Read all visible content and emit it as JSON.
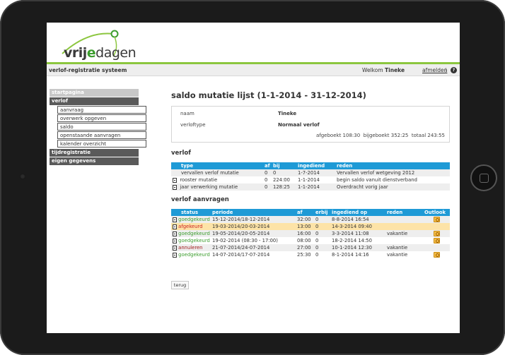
{
  "header": {
    "logo_part1": "vrij",
    "logo_part2": "e",
    "logo_part3": "dagen",
    "system_title": "verlof-registratie systeem",
    "welcome_label": "Welkom",
    "username": "Tineke",
    "logout_label": "afmelden",
    "separator": "|",
    "help_icon": "help-icon"
  },
  "sidebar": {
    "startpagina": "startpagina",
    "verlof": "verlof",
    "sub_items": [
      "aanvraag",
      "overwerk opgeven",
      "saldo",
      "openstaande aanvragen",
      "kalender overzicht"
    ],
    "tijdregistratie": "tijdregistratie",
    "eigen_gegevens": "eigen gegevens"
  },
  "main": {
    "title": "saldo mutatie lijst (1-1-2014 - 31-12-2014)",
    "info": {
      "naam_label": "naam",
      "naam_value": "Tineke",
      "verloftype_label": "verloftype",
      "verloftype_value": "Normaal verlof",
      "afgeboekt": "afgeboekt 108:30",
      "bijgeboekt": "bijgeboekt 352:25",
      "totaal": "totaal 243:55"
    },
    "verlof_section_title": "verlof",
    "verlof_table": {
      "headers": [
        "type",
        "af",
        "bij",
        "ingediend",
        "reden"
      ],
      "rows": [
        [
          "vervallen verlof mutatie",
          "0",
          "0",
          "1-7-2014",
          "Vervallen verlof wetgeving 2012"
        ],
        [
          "rooster mutatie",
          "0",
          "224:00",
          "1-1-2014",
          "begin saldo vanuit dienstverband"
        ],
        [
          "jaar verwerking mutatie",
          "0",
          "128:25",
          "1-1-2014",
          "Overdracht vorig jaar"
        ]
      ]
    },
    "aanvragen_section_title": "verlof aanvragen",
    "aanvragen_table": {
      "headers": [
        "status",
        "periode",
        "af",
        "erbij",
        "ingediend op",
        "reden",
        "Outlook"
      ],
      "rows": [
        [
          "goedgekeurd",
          "15-12-2014/18-12-2014",
          "32:00",
          "0",
          "8-8-2014 16:54",
          "",
          "yes"
        ],
        [
          "afgekeurd",
          "19-03-2014/20-03-2014",
          "13:00",
          "0",
          "14-3-2014 09:40",
          "",
          ""
        ],
        [
          "goedgekeurd",
          "19-05-2014/20-05-2014",
          "16:00",
          "0",
          "3-3-2014 11:08",
          "vakantie",
          "yes"
        ],
        [
          "goedgekeurd",
          "19-02-2014 (08:30 - 17:00)",
          "08:00",
          "0",
          "18-2-2014 14:50",
          "",
          "yes"
        ],
        [
          "annuleren",
          "21-07-2014/24-07-2014",
          "27:00",
          "0",
          "10-1-2014 12:30",
          "vakantie",
          ""
        ],
        [
          "goedgekeurd",
          "14-07-2014/17-07-2014",
          "25:30",
          "0",
          "8-1-2014 14:16",
          "vakantie",
          "yes"
        ]
      ]
    },
    "back_label": "terug"
  },
  "colors": {
    "accent_green": "#8cc63f",
    "table_header_blue": "#1e9ad6",
    "status_green": "#3c9d2e",
    "status_red": "#cc2222",
    "highlight_row": "#fde3a7"
  }
}
